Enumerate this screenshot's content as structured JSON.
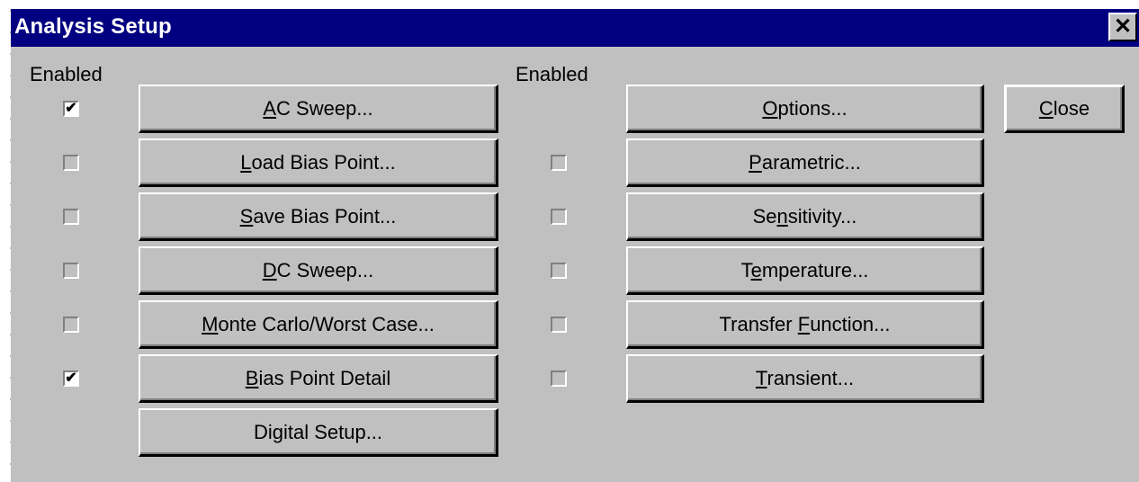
{
  "window": {
    "title": "Analysis Setup",
    "close_icon": "✕"
  },
  "left_column": {
    "enabled_header": "Enabled",
    "items": [
      {
        "pre": "",
        "key": "A",
        "post": "C Sweep...",
        "checked": true,
        "checkbox_visible": true
      },
      {
        "pre": "",
        "key": "L",
        "post": "oad Bias Point...",
        "checked": false,
        "checkbox_visible": true
      },
      {
        "pre": "",
        "key": "S",
        "post": "ave Bias Point...",
        "checked": false,
        "checkbox_visible": true
      },
      {
        "pre": "",
        "key": "D",
        "post": "C Sweep...",
        "checked": false,
        "checkbox_visible": true
      },
      {
        "pre": "",
        "key": "M",
        "post": "onte Carlo/Worst Case...",
        "checked": false,
        "checkbox_visible": true
      },
      {
        "pre": "",
        "key": "B",
        "post": "ias Point Detail",
        "checked": true,
        "checkbox_visible": true
      },
      {
        "pre": "Di",
        "key": "g",
        "post": "ital Setup...",
        "checked": false,
        "checkbox_visible": false
      }
    ]
  },
  "right_column": {
    "enabled_header": "Enabled",
    "items": [
      {
        "pre": "",
        "key": "O",
        "post": "ptions...",
        "checked": false,
        "checkbox_visible": false
      },
      {
        "pre": "",
        "key": "P",
        "post": "arametric...",
        "checked": false,
        "checkbox_visible": true
      },
      {
        "pre": "Se",
        "key": "n",
        "post": "sitivity...",
        "checked": false,
        "checkbox_visible": true
      },
      {
        "pre": "T",
        "key": "e",
        "post": "mperature...",
        "checked": false,
        "checkbox_visible": true
      },
      {
        "pre": "Transfer ",
        "key": "F",
        "post": "unction...",
        "checked": false,
        "checkbox_visible": true
      },
      {
        "pre": "",
        "key": "T",
        "post": "ransient...",
        "checked": false,
        "checkbox_visible": true
      }
    ]
  },
  "close_button": {
    "pre": "",
    "key": "C",
    "post": "lose"
  },
  "checkmark_glyph": "✔",
  "colors": {
    "titlebar": "#000080",
    "face": "#c0c0c0",
    "title_text": "#ffffff"
  }
}
